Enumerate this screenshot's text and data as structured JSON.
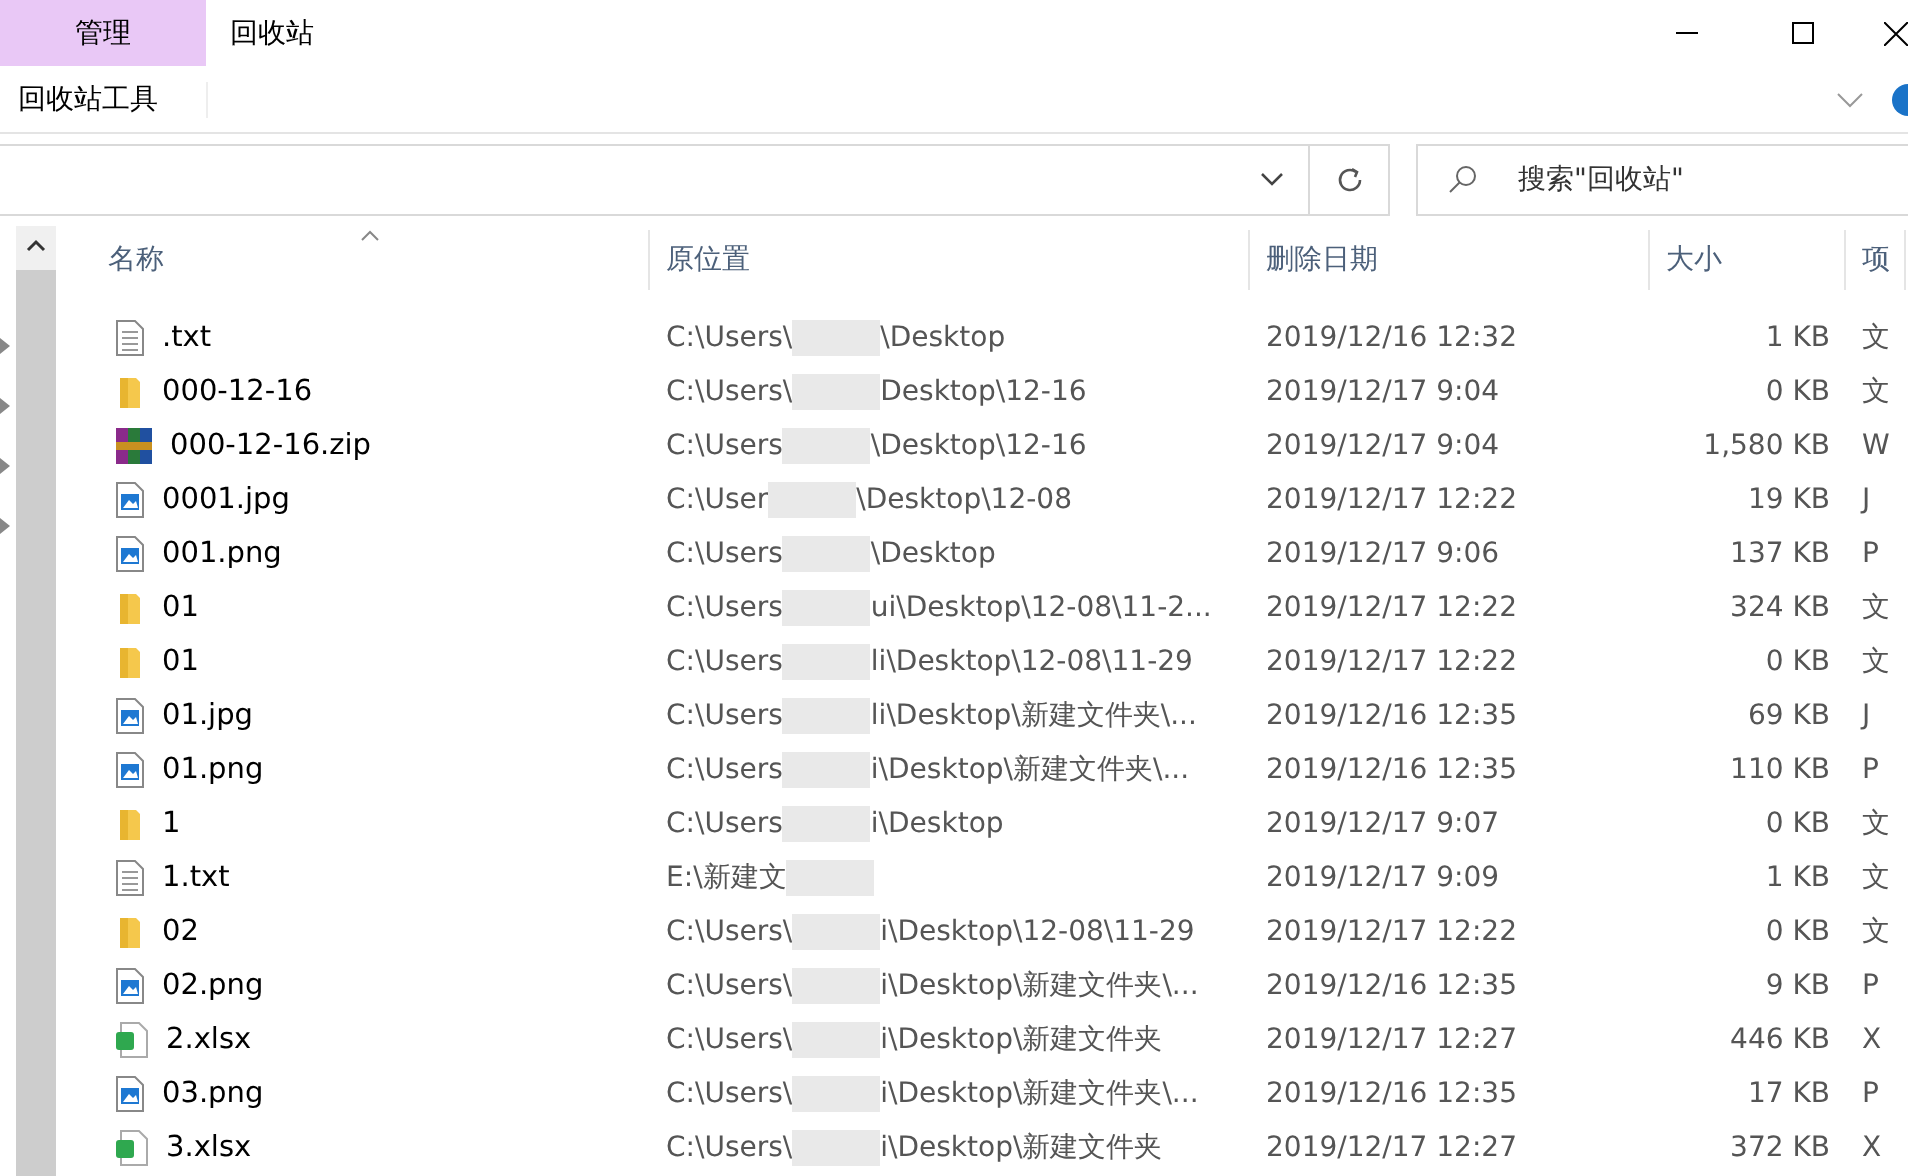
{
  "ribbon": {
    "context_tab": "管理",
    "context_group": "回收站工具"
  },
  "window": {
    "title": "回收站"
  },
  "search": {
    "placeholder": "搜索\"回收站\""
  },
  "columns": [
    {
      "label": "名称",
      "sorted": true
    },
    {
      "label": "原位置",
      "sorted": false
    },
    {
      "label": "删除日期",
      "sorted": false
    },
    {
      "label": "大小",
      "sorted": false
    },
    {
      "label": "项",
      "sorted": false
    }
  ],
  "rows": [
    {
      "kind": "text",
      "name": ".txt",
      "location_start": "C:\\Users\\",
      "location_end": "\\Desktop",
      "deleted": "2019/12/16 12:32",
      "size": "1 KB",
      "column_5": "文"
    },
    {
      "kind": "folder",
      "name": "000-12-16",
      "location_start": "C:\\Users\\",
      "location_end": "Desktop\\12-16",
      "deleted": "2019/12/17 9:04",
      "size": "0 KB",
      "column_5": "文"
    },
    {
      "kind": "archive",
      "name": "000-12-16.zip",
      "location_start": "C:\\Users",
      "location_end": "\\Desktop\\12-16",
      "deleted": "2019/12/17 9:04",
      "size": "1,580 KB",
      "column_5": "W"
    },
    {
      "kind": "image",
      "name": "0001.jpg",
      "location_start": "C:\\User",
      "location_end": "\\Desktop\\12-08",
      "deleted": "2019/12/17 12:22",
      "size": "19 KB",
      "column_5": "J"
    },
    {
      "kind": "image",
      "name": "001.png",
      "location_start": "C:\\Users",
      "location_end": "\\Desktop",
      "deleted": "2019/12/17 9:06",
      "size": "137 KB",
      "column_5": "P"
    },
    {
      "kind": "folder",
      "name": "01",
      "location_start": "C:\\Users",
      "location_end": "ui\\Desktop\\12-08\\11-2...",
      "deleted": "2019/12/17 12:22",
      "size": "324 KB",
      "column_5": "文"
    },
    {
      "kind": "folder",
      "name": "01",
      "location_start": "C:\\Users",
      "location_end": "li\\Desktop\\12-08\\11-29",
      "deleted": "2019/12/17 12:22",
      "size": "0 KB",
      "column_5": "文"
    },
    {
      "kind": "image",
      "name": "01.jpg",
      "location_start": "C:\\Users",
      "location_end": "li\\Desktop\\新建文件夹\\...",
      "deleted": "2019/12/16 12:35",
      "size": "69 KB",
      "column_5": "J"
    },
    {
      "kind": "image",
      "name": "01.png",
      "location_start": "C:\\Users",
      "location_end": "i\\Desktop\\新建文件夹\\...",
      "deleted": "2019/12/16 12:35",
      "size": "110 KB",
      "column_5": "P"
    },
    {
      "kind": "folder",
      "name": "1",
      "location_start": "C:\\Users",
      "location_end": "i\\Desktop",
      "deleted": "2019/12/17 9:07",
      "size": "0 KB",
      "column_5": "文"
    },
    {
      "kind": "text",
      "name": "1.txt",
      "location_start": "E:\\新建文",
      "location_end": "",
      "deleted": "2019/12/17 9:09",
      "size": "1 KB",
      "column_5": "文"
    },
    {
      "kind": "folder",
      "name": "02",
      "location_start": "C:\\Users\\",
      "location_end": "i\\Desktop\\12-08\\11-29",
      "deleted": "2019/12/17 12:22",
      "size": "0 KB",
      "column_5": "文"
    },
    {
      "kind": "image",
      "name": "02.png",
      "location_start": "C:\\Users\\",
      "location_end": "i\\Desktop\\新建文件夹\\...",
      "deleted": "2019/12/16 12:35",
      "size": "9 KB",
      "column_5": "P"
    },
    {
      "kind": "sheet",
      "name": "2.xlsx",
      "location_start": "C:\\Users\\",
      "location_end": "i\\Desktop\\新建文件夹",
      "deleted": "2019/12/17 12:27",
      "size": "446 KB",
      "column_5": "X"
    },
    {
      "kind": "image",
      "name": "03.png",
      "location_start": "C:\\Users\\",
      "location_end": "i\\Desktop\\新建文件夹\\...",
      "deleted": "2019/12/16 12:35",
      "size": "17 KB",
      "column_5": "P"
    },
    {
      "kind": "sheet",
      "name": "3.xlsx",
      "location_start": "C:\\Users\\",
      "location_end": "i\\Desktop\\新建文件夹",
      "deleted": "2019/12/17 12:27",
      "size": "372 KB",
      "column_5": "X"
    }
  ]
}
